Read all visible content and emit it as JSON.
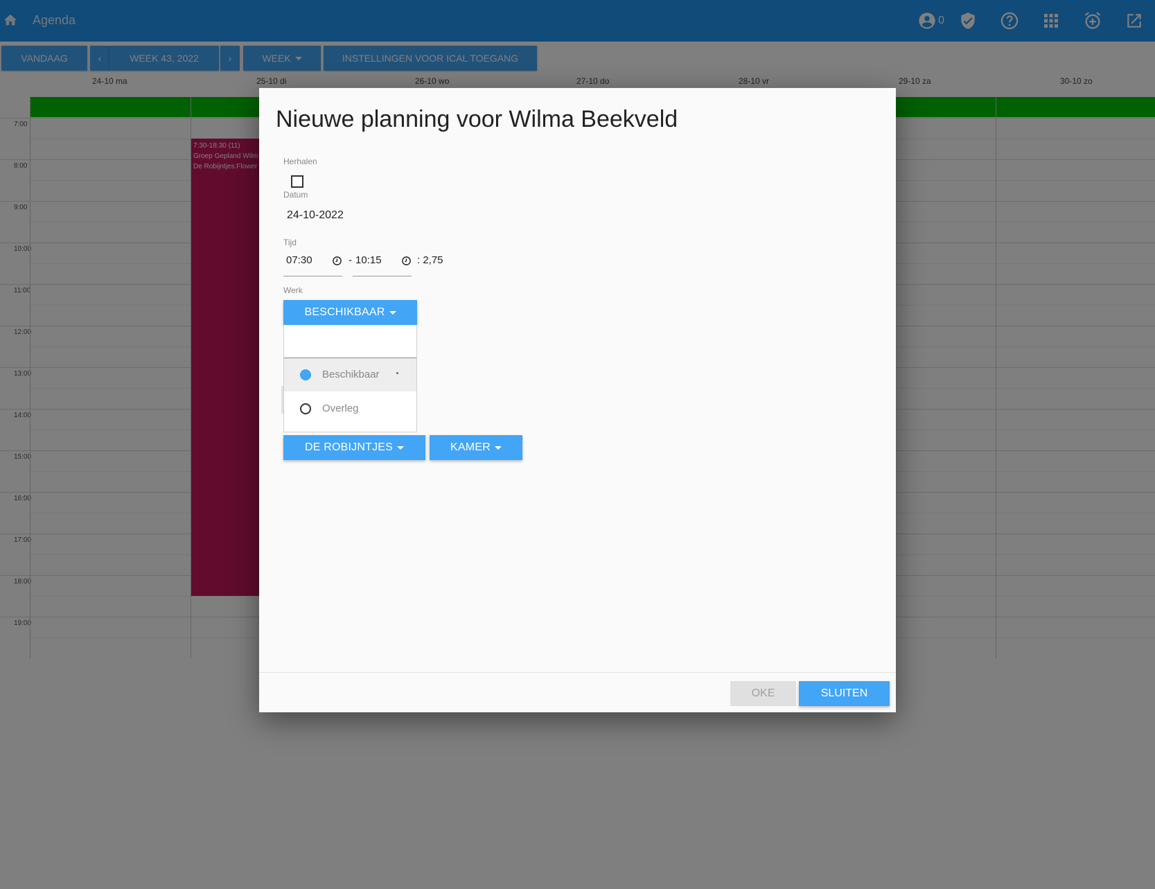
{
  "app": {
    "title": "Agenda",
    "notification_count": "0",
    "icons": [
      "home-icon",
      "account-circle-icon",
      "shield-check-icon",
      "help-circle-icon",
      "apps-grid-icon",
      "alarm-add-icon",
      "open-external-icon"
    ],
    "bar_color": "#2196f3"
  },
  "toolbar": {
    "today_label": "VANDAAG",
    "prev_label": "‹",
    "week_label": "WEEK 43, 2022",
    "next_label": "›",
    "view_label": "WEEK",
    "ical_label": "INSTELLINGEN VOOR ICAL TOEGANG"
  },
  "calendar": {
    "days": [
      "24-10 ma",
      "25-10 di",
      "26-10 wo",
      "27-10 do",
      "28-10 vr",
      "29-10 za",
      "30-10 zo"
    ],
    "hours": [
      "7:00",
      "8:00",
      "9:00",
      "10:00",
      "11:00",
      "12:00",
      "13:00",
      "14:00",
      "15:00",
      "16:00",
      "17:00",
      "18:00",
      "19:00"
    ],
    "event": {
      "time": "7:30-18:30 (11)",
      "line1": "Groep Gepland Wilm",
      "line2": "De Robijntjes:Flower"
    },
    "colors": {
      "availability_bar": "#00c200",
      "event": "#c2185b"
    }
  },
  "dialog": {
    "title": "Nieuwe planning voor Wilma Beekveld",
    "repeat_label": "Herhalen",
    "date_label": "Datum",
    "date_value": "24-10-2022",
    "time_label": "Tijd",
    "time_start": "07:30",
    "time_sep": "-",
    "time_end": "10:15",
    "duration": ": 2,75",
    "work_label": "Werk",
    "work_button": "BESCHIKBAAR",
    "work_options": [
      {
        "label": "Beschikbaar",
        "selected": true
      },
      {
        "label": "Overleg",
        "selected": false
      }
    ],
    "group_button": "DE ROBIJNTJES",
    "room_button": "KAMER",
    "ok_label": "OKE",
    "close_label": "SLUITEN",
    "accent_color": "#42a5f5"
  }
}
